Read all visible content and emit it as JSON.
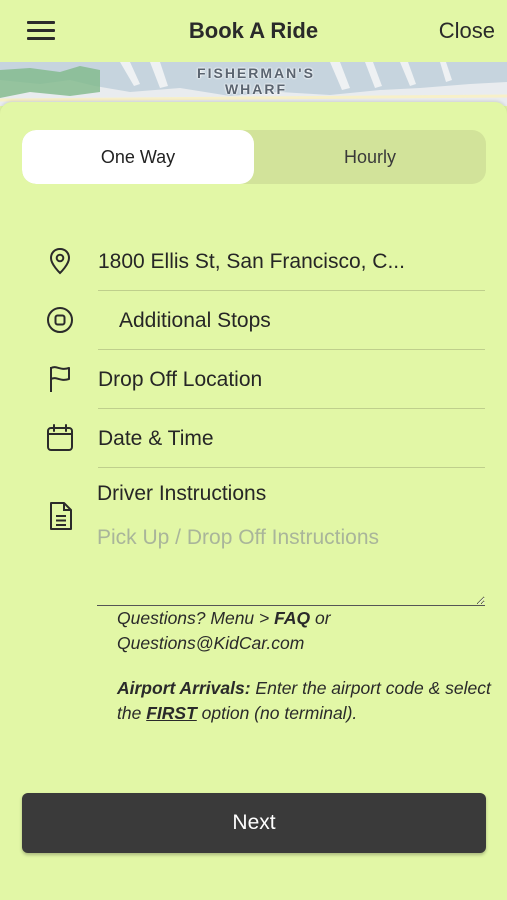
{
  "header": {
    "title": "Book A Ride",
    "close_label": "Close",
    "menu_icon": "hamburger-menu-icon"
  },
  "map": {
    "label": "FISHERMAN'S WHARF"
  },
  "ride_type": {
    "options": [
      "One Way",
      "Hourly"
    ],
    "selected": "One Way"
  },
  "form": {
    "pickup": {
      "icon": "location-pin-icon",
      "value": "1800 Ellis St, San Francisco, C..."
    },
    "stops": {
      "icon": "stop-circle-icon",
      "label": "Additional Stops"
    },
    "dropoff": {
      "icon": "flag-icon",
      "label": "Drop Off Location"
    },
    "datetime": {
      "icon": "calendar-icon",
      "label": "Date & Time"
    },
    "instructions": {
      "icon": "document-icon",
      "label": "Driver Instructions",
      "placeholder": "Pick Up / Drop Off Instructions"
    }
  },
  "notes": {
    "faq_prefix": "Questions? Menu > ",
    "faq_bold": "FAQ",
    "faq_suffix": " or",
    "email": "Questions@KidCar.com",
    "airport_bold": "Airport Arrivals:",
    "airport_text1": " Enter the airport code & select the ",
    "airport_first": "FIRST",
    "airport_text2": " option (no terminal)."
  },
  "next_label": "Next",
  "colors": {
    "background": "#e2f7a6",
    "button": "#3a3a3a",
    "segment_inactive": "#d2e39a"
  }
}
